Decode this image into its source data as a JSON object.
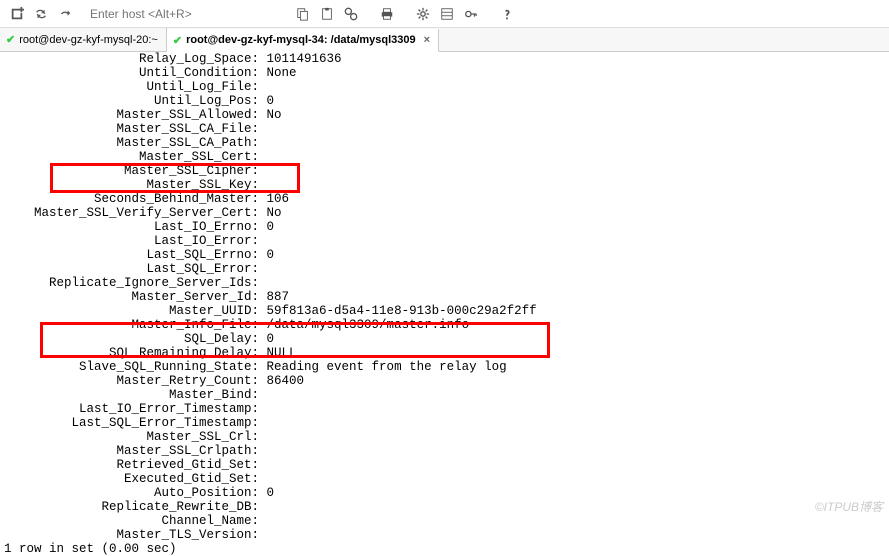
{
  "toolbar": {
    "host_placeholder": "Enter host <Alt+R>"
  },
  "tabs": [
    {
      "label": "root@dev-gz-kyf-mysql-20:~",
      "active": false,
      "closeable": false
    },
    {
      "label": "root@dev-gz-kyf-mysql-34: /data/mysql3309",
      "active": true,
      "closeable": true
    }
  ],
  "status": {
    "lines": [
      {
        "k": "Relay_Log_Space",
        "v": "1011491636"
      },
      {
        "k": "Until_Condition",
        "v": "None"
      },
      {
        "k": "Until_Log_File",
        "v": ""
      },
      {
        "k": "Until_Log_Pos",
        "v": "0"
      },
      {
        "k": "Master_SSL_Allowed",
        "v": "No"
      },
      {
        "k": "Master_SSL_CA_File",
        "v": ""
      },
      {
        "k": "Master_SSL_CA_Path",
        "v": ""
      },
      {
        "k": "Master_SSL_Cert",
        "v": ""
      },
      {
        "k": "Master_SSL_Cipher",
        "v": ""
      },
      {
        "k": "Master_SSL_Key",
        "v": ""
      },
      {
        "k": "Seconds_Behind_Master",
        "v": "106"
      },
      {
        "k": "Master_SSL_Verify_Server_Cert",
        "v": "No"
      },
      {
        "k": "Last_IO_Errno",
        "v": "0"
      },
      {
        "k": "Last_IO_Error",
        "v": ""
      },
      {
        "k": "Last_SQL_Errno",
        "v": "0"
      },
      {
        "k": "Last_SQL_Error",
        "v": ""
      },
      {
        "k": "Replicate_Ignore_Server_Ids",
        "v": ""
      },
      {
        "k": "Master_Server_Id",
        "v": "887"
      },
      {
        "k": "Master_UUID",
        "v": "59f813a6-d5a4-11e8-913b-000c29a2f2ff"
      },
      {
        "k": "Master_Info_File",
        "v": "/data/mysql3309/master.info"
      },
      {
        "k": "SQL_Delay",
        "v": "0"
      },
      {
        "k": "SQL_Remaining_Delay",
        "v": "NULL"
      },
      {
        "k": "Slave_SQL_Running_State",
        "v": "Reading event from the relay log"
      },
      {
        "k": "Master_Retry_Count",
        "v": "86400"
      },
      {
        "k": "Master_Bind",
        "v": ""
      },
      {
        "k": "Last_IO_Error_Timestamp",
        "v": ""
      },
      {
        "k": "Last_SQL_Error_Timestamp",
        "v": ""
      },
      {
        "k": "Master_SSL_Crl",
        "v": ""
      },
      {
        "k": "Master_SSL_Crlpath",
        "v": ""
      },
      {
        "k": "Retrieved_Gtid_Set",
        "v": ""
      },
      {
        "k": "Executed_Gtid_Set",
        "v": ""
      },
      {
        "k": "Auto_Position",
        "v": "0"
      },
      {
        "k": "Replicate_Rewrite_DB",
        "v": ""
      },
      {
        "k": "Channel_Name",
        "v": ""
      },
      {
        "k": "Master_TLS_Version",
        "v": ""
      }
    ],
    "footer": "1 row in set (0.00 sec)"
  },
  "watermark": "©ITPUB博客",
  "layout": {
    "colon_col": 33
  }
}
